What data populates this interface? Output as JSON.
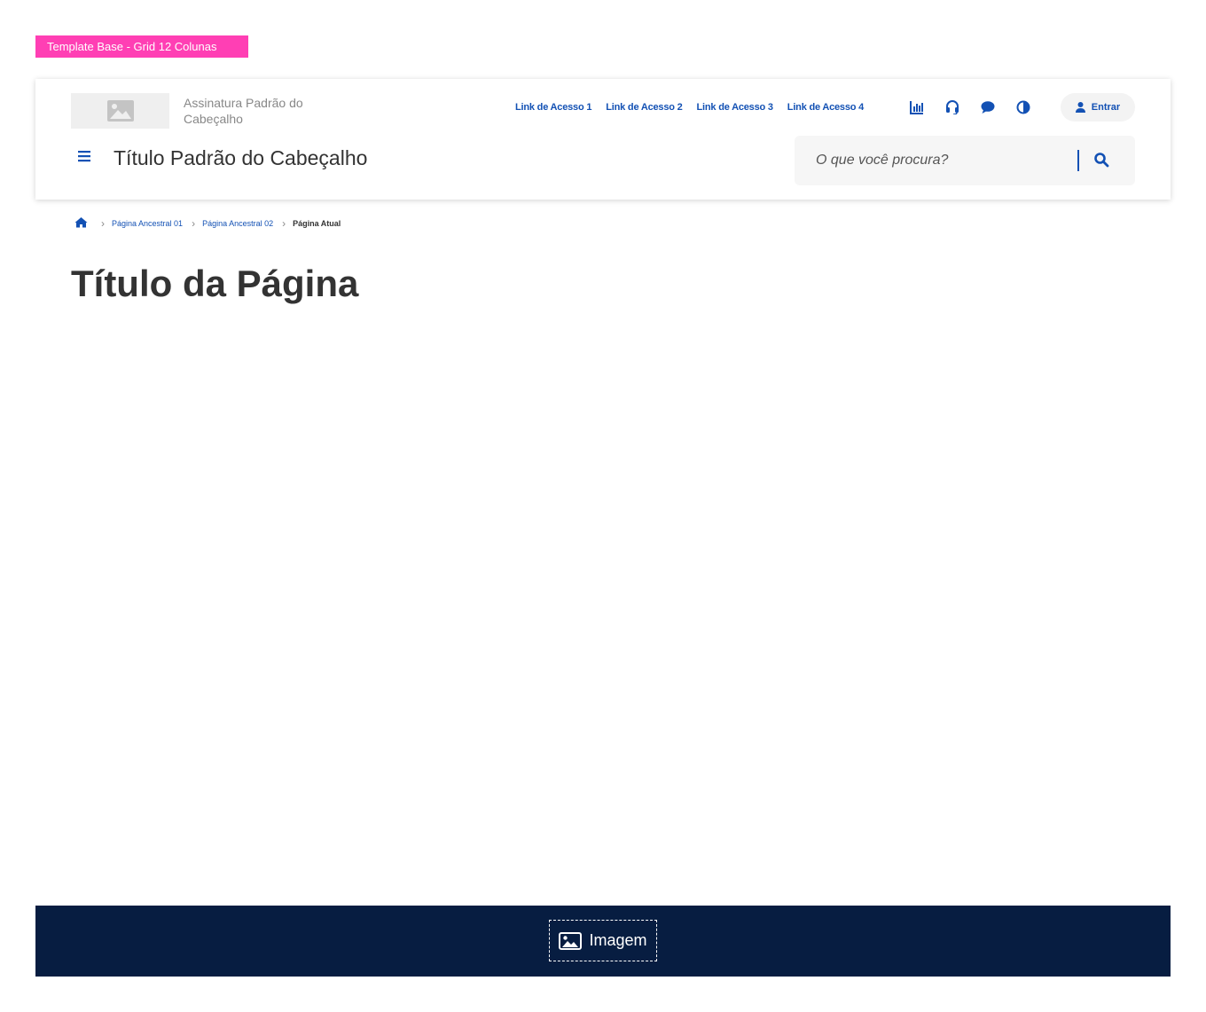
{
  "template_tag": "Template Base - Grid 12 Colunas",
  "header": {
    "logo_icon": "image-icon",
    "signature": "Assinatura Padrão do Cabeçalho",
    "links": [
      "Link de Acesso 1",
      "Link de Acesso 2",
      "Link de Acesso 3",
      "Link de Acesso 4"
    ],
    "function_icons": [
      "chart-icon",
      "headset-icon",
      "chat-icon",
      "contrast-icon"
    ],
    "login_label": "Entrar",
    "title": "Título Padrão do Cabeçalho",
    "search_placeholder": "O que você procura?"
  },
  "breadcrumb": {
    "items": [
      "Página Ancestral 01",
      "Página Ancestral 02"
    ],
    "current": "Página Atual"
  },
  "page_title": "Título da Página",
  "footer": {
    "image_label": "Imagem"
  },
  "colors": {
    "accent": "#1351b4",
    "tag": "#ff3fb4",
    "footer_bg": "#071d41"
  }
}
